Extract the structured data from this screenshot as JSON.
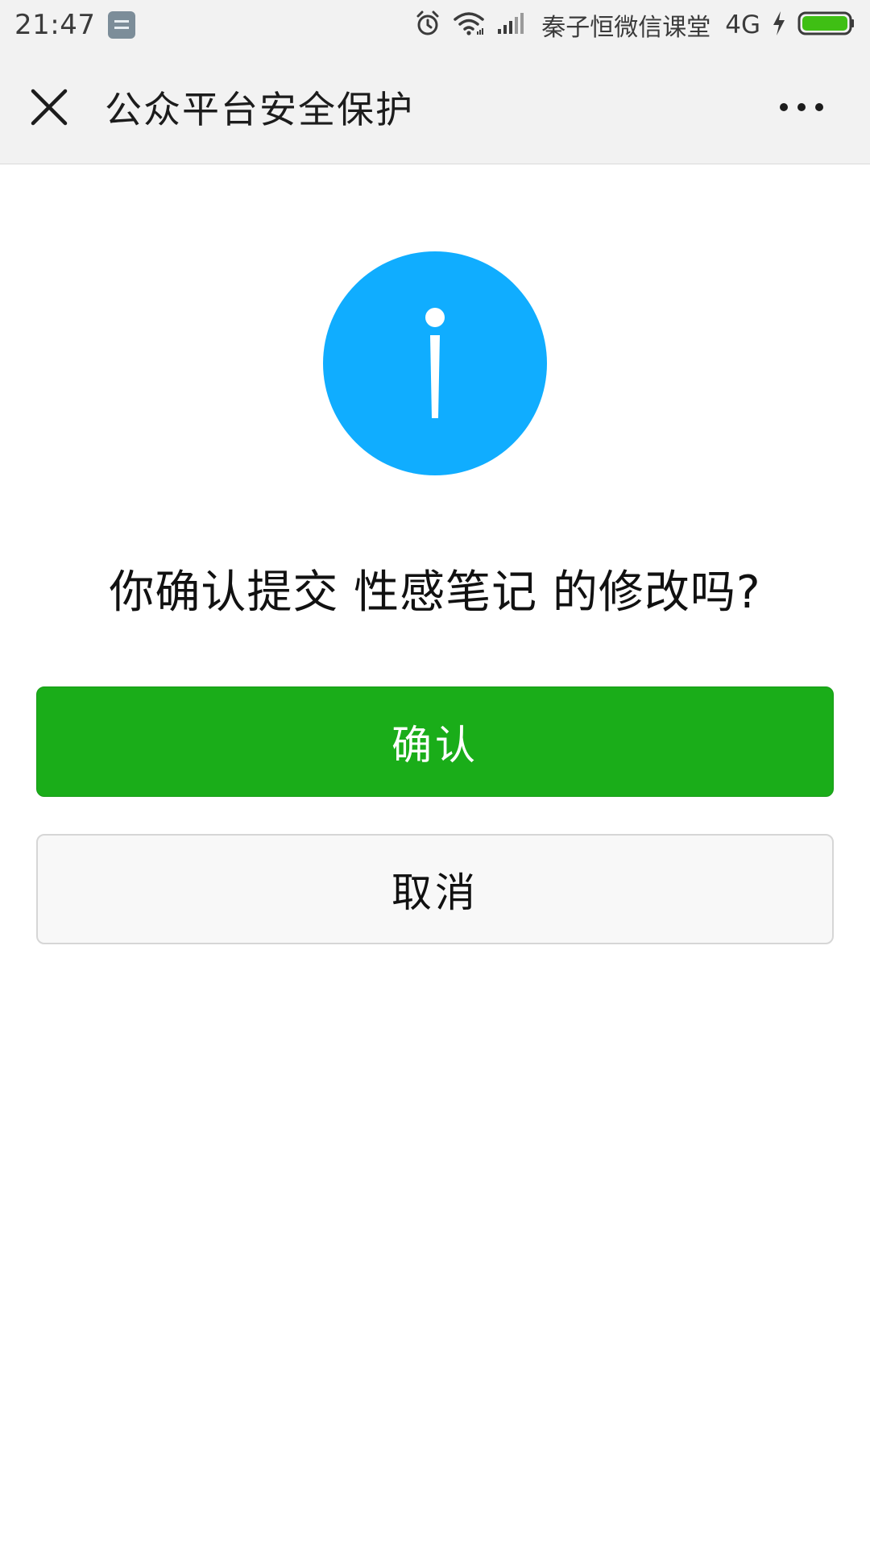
{
  "status_bar": {
    "time": "21:47",
    "carrier": "秦子恒微信课堂",
    "network": "4G",
    "icons": [
      "notification-icon",
      "alarm-icon",
      "wifi-icon",
      "signal-icon",
      "charging-icon",
      "battery-icon"
    ],
    "battery_level": 1.0
  },
  "header": {
    "title": "公众平台安全保护",
    "close_icon": "close-icon",
    "more_icon": "more-icon"
  },
  "dialog": {
    "icon": "info-icon",
    "message": "你确认提交 性感笔记 的修改吗?",
    "confirm_label": "确认",
    "cancel_label": "取消"
  },
  "colors": {
    "info_blue": "#10adff",
    "confirm_green": "#1aad19",
    "battery_green": "#3fbf14",
    "bar_gray": "#f2f2f2"
  }
}
